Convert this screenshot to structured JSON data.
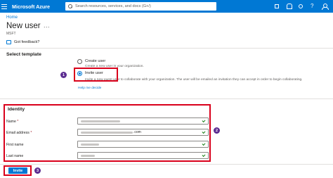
{
  "app": {
    "brand": "Microsoft Azure",
    "search_placeholder": "Search resources, services, and docs (G+/)"
  },
  "breadcrumb": "Home",
  "page": {
    "title": "New user",
    "more": "...",
    "subtitle": "MSFT"
  },
  "toolbar": {
    "feedback_label": "Got feedback?"
  },
  "template": {
    "heading": "Select template",
    "options": [
      {
        "label": "Create user",
        "description": "Create a new user in your organization.",
        "selected": false
      },
      {
        "label": "Invite user",
        "description": "Invite a new guest user to collaborate with your organization. The user will be emailed an invitation they can accept in order to begin collaborating.",
        "selected": true
      }
    ],
    "help_link": "Help me decide"
  },
  "identity": {
    "heading": "Identity",
    "fields": [
      {
        "label": "Name",
        "required": true
      },
      {
        "label": "Email address",
        "required": true,
        "suffix": ".com"
      },
      {
        "label": "First name",
        "required": false
      },
      {
        "label": "Last name",
        "required": false
      }
    ]
  },
  "actions": {
    "invite_label": "Invite"
  },
  "annotations": [
    "1",
    "2",
    "3"
  ],
  "colors": {
    "azure_blue": "#0078d4",
    "highlight_red": "#d9001b",
    "marker_purple": "#5c2d91"
  },
  "icons": [
    "hamburger-icon",
    "search-icon",
    "cloud-shell-icon",
    "notifications-icon",
    "settings-icon",
    "help-icon",
    "account-icon",
    "feedback-icon",
    "checkmark-icon"
  ]
}
